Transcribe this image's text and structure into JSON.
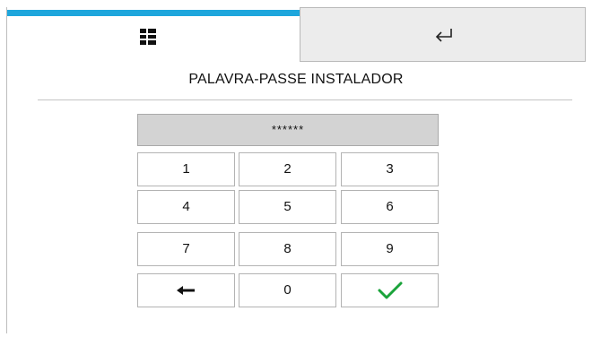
{
  "header": {
    "tabs": [
      {
        "name": "home",
        "icon": "grid-icon",
        "active": true
      },
      {
        "name": "back",
        "icon": "return-arrow-icon",
        "active": false
      }
    ],
    "accent_color": "#1ea6dc"
  },
  "page": {
    "title": "PALAVRA-PASSE INSTALADOR"
  },
  "keypad": {
    "display_value": "******",
    "keys": {
      "k1": "1",
      "k2": "2",
      "k3": "3",
      "k4": "4",
      "k5": "5",
      "k6": "6",
      "k7": "7",
      "k8": "8",
      "k9": "9",
      "k0": "0"
    },
    "backspace_icon": "left-arrow-icon",
    "confirm_icon": "checkmark-icon",
    "confirm_color": "#1aa33a"
  }
}
